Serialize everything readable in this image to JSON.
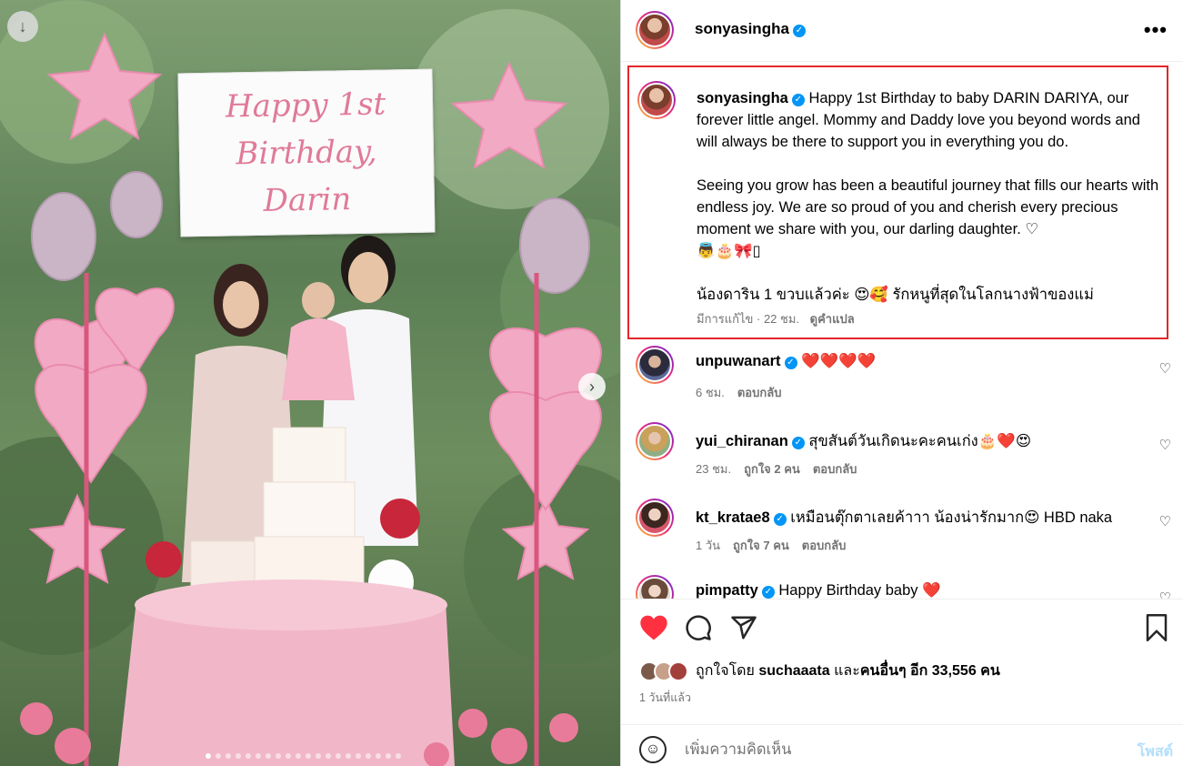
{
  "media": {
    "banner_text": "Happy 1st\nBirthday,\nDarin",
    "download_icon": "download-icon",
    "next_icon": "chevron-right-icon",
    "carousel": {
      "count": 20,
      "active": 0
    }
  },
  "header": {
    "username": "sonyasingha",
    "verified_glyph": "✓",
    "more_glyph": "•••"
  },
  "caption": {
    "username": "sonyasingha",
    "paragraphs": [
      "Happy 1st Birthday to baby DARIN DARIYA, our forever little angel. Mommy and Daddy love you beyond words and will always be there to support you in everything you do.",
      "Seeing you grow has been a beautiful journey that fills our hearts with endless joy. We are so proud of you and cherish every precious moment we share with you, our darling daughter. ♡\n👼🎂🎀▯",
      "น้องดาริน 1 ขวบแล้วค่ะ 😍🥰 รักหนูที่สุดในโลกนางฟ้าของแม่"
    ],
    "edited": "มีการแก้ไข · 22 ชม.",
    "translate": "ดูคำแปล"
  },
  "comments": [
    {
      "username": "unpuwanart",
      "text": "❤️❤️❤️❤️",
      "time": "6 ชม.",
      "likes": "",
      "reply": "ตอบกลับ"
    },
    {
      "username": "yui_chiranan",
      "text": "สุขสันต์วันเกิดนะคะคนเก่ง🎂❤️😍",
      "time": "23 ชม.",
      "likes": "ถูกใจ 2 คน",
      "reply": "ตอบกลับ"
    },
    {
      "username": "kt_kratae8",
      "text": "เหมือนตุ๊กตาเลยค้าาา น้องน่ารักมาก😍 HBD naka",
      "time": "1 วัน",
      "likes": "ถูกใจ 7 คน",
      "reply": "ตอบกลับ"
    },
    {
      "username": "pimpatty",
      "text": "Happy Birthday baby ❤️",
      "time": "",
      "likes": "",
      "reply": ""
    }
  ],
  "actions": {
    "like_icon": "heart-filled-icon",
    "comment_icon": "comment-icon",
    "share_icon": "share-icon",
    "save_icon": "bookmark-icon",
    "like_color": "#ff3040"
  },
  "likes": {
    "prefix": "ถูกใจโดย",
    "first_user": "suchaaata",
    "middle": "และ",
    "others": "คนอื่นๆ อีก 33,556 คน"
  },
  "posted": "1 วันที่แล้ว",
  "add_comment": {
    "placeholder": "เพิ่มความคิดเห็น",
    "post_label": "โพสต์"
  }
}
